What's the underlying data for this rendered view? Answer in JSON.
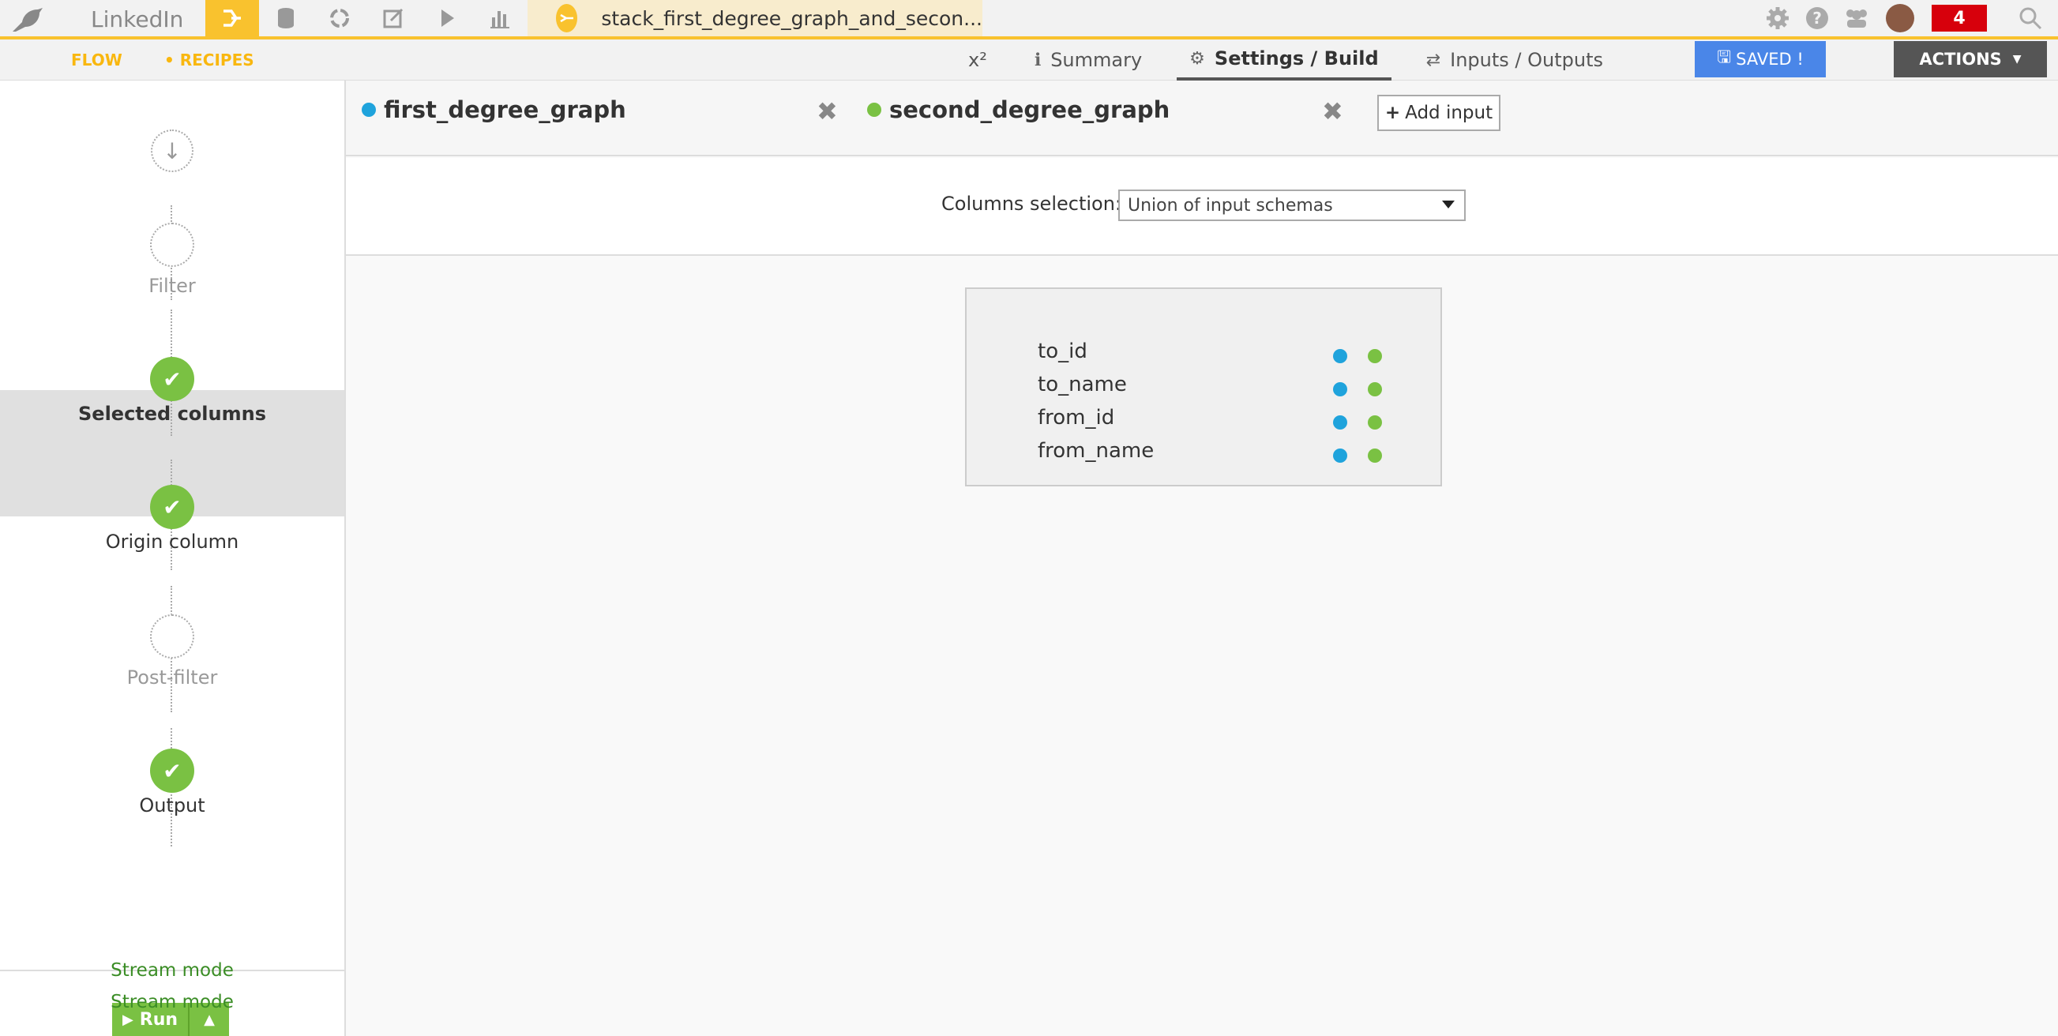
{
  "app": {
    "project_name": "LinkedIn",
    "recipe_name": "stack_first_degree_graph_and_secon...",
    "notifications_count": "4"
  },
  "colors": {
    "accent": "#f9c22e",
    "input1": "#1fa3dc",
    "input2": "#7ac143",
    "saved": "#4a86e8",
    "badge": "#d7000c"
  },
  "subnav": {
    "flow": "FLOW",
    "recipes": "• RECIPES",
    "tabs": [
      {
        "label": "x²",
        "icon": ""
      },
      {
        "label": "Summary",
        "icon": "info-icon"
      },
      {
        "label": "Settings / Build",
        "icon": "gear-icon"
      },
      {
        "label": "Inputs / Outputs",
        "icon": "swap-icon"
      }
    ],
    "saved_label": "SAVED !",
    "actions_label": "ACTIONS"
  },
  "steps": [
    {
      "label": "Filter"
    },
    {
      "label": "Selected columns"
    },
    {
      "label": "Origin column"
    },
    {
      "label": "Post-filter"
    },
    {
      "label": "Output"
    }
  ],
  "run": {
    "run_label": "Run",
    "stream_mode_1": "Stream mode",
    "stream_mode_2": "Stream mode"
  },
  "inputs": [
    {
      "name": "first_degree_graph"
    },
    {
      "name": "second_degree_graph"
    }
  ],
  "add_input_label": "Add input",
  "columns_selection": {
    "label": "Columns selection:",
    "value": "Union of input schemas"
  },
  "columns": [
    "to_id",
    "to_name",
    "from_id",
    "from_name"
  ]
}
